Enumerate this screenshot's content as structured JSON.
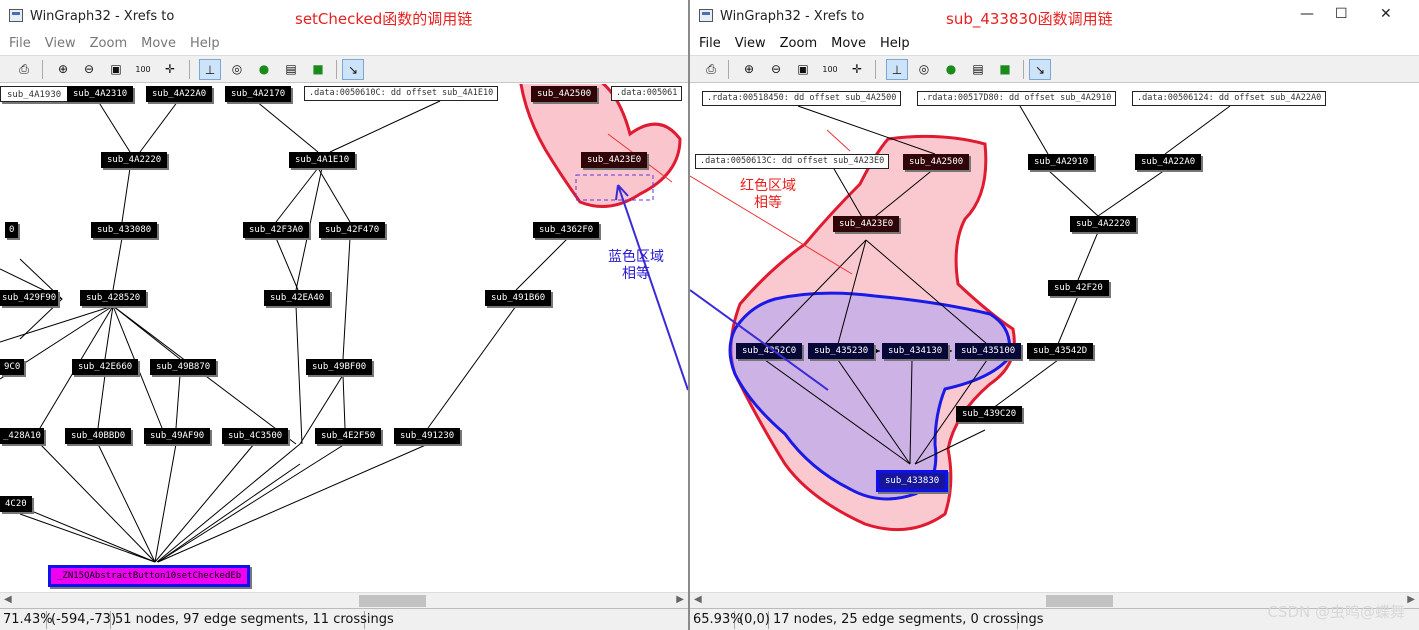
{
  "left_window": {
    "title": "WinGraph32 - Xrefs to",
    "annotation_title": "setChecked函数的调用链",
    "menu": [
      "File",
      "View",
      "Zoom",
      "Move",
      "Help"
    ],
    "nodes": [
      "sub_4A1930",
      "sub_4A2310",
      "sub_4A22A0",
      "sub_4A2170",
      "sub_4A2500",
      "sub_4A2220",
      "sub_4A1E10",
      "sub_4A23E0",
      "0",
      "sub_433080",
      "sub_42F3A0",
      "sub_42F470",
      "sub_4362F0",
      "sub_429F90",
      "sub_428520",
      "sub_42EA40",
      "sub_491B60",
      "9C0",
      "sub_42E660",
      "sub_49B870",
      "sub_49BF00",
      "_428A10",
      "sub_40BBD0",
      "sub_49AF90",
      "sub_4C3500",
      "sub_4E2F50",
      "sub_491230",
      "4C20",
      "_ZN15QAbstractButton10setCheckedEb"
    ],
    "data_nodes": [
      ".data:0050610C: dd offset sub_4A1E10",
      ".data:005061"
    ],
    "blue_annotation": [
      "蓝色区域",
      "相等"
    ],
    "status": {
      "zoom": "71.43%",
      "coords": "(-594,-73)",
      "info": "51 nodes, 97 edge segments, 11 crossings"
    }
  },
  "right_window": {
    "title": "WinGraph32 - Xrefs to",
    "annotation_title": "sub_433830函数调用链",
    "menu": [
      "File",
      "View",
      "Zoom",
      "Move",
      "Help"
    ],
    "window_controls": [
      "—",
      "☐",
      "✕"
    ],
    "data_nodes": [
      ".rdata:00518450: dd offset sub_4A2500",
      ".rdata:00517D80: dd offset sub_4A2910",
      ".data:00506124: dd offset sub_4A22A0",
      ".data:0050613C: dd offset sub_4A23E0"
    ],
    "nodes": [
      "sub_4A2500",
      "sub_4A2910",
      "sub_4A22A0",
      "sub_4A23E0",
      "sub_4A2220",
      "sub_42F20",
      "sub_4352C0",
      "sub_435230",
      "sub_434130",
      "sub_435100",
      "sub_43542D",
      "sub_439C20",
      "sub_433830"
    ],
    "red_annotation": [
      "红色区域",
      "相等"
    ],
    "status": {
      "zoom": "65.93%",
      "coords": "(0,0)",
      "info": "17 nodes, 25 edge segments, 0 crossings"
    }
  },
  "toolbar_icons": [
    "print-icon",
    "zoom-in-icon",
    "zoom-out-icon",
    "zoom-fit-icon",
    "zoom-100-icon",
    "move-icon",
    "layout-icon",
    "globe-icon",
    "green-circle-icon",
    "frame-icon",
    "green-arrow-icon",
    "pointer-icon"
  ],
  "watermark": "CSDN @虫鸣@蝶舞"
}
